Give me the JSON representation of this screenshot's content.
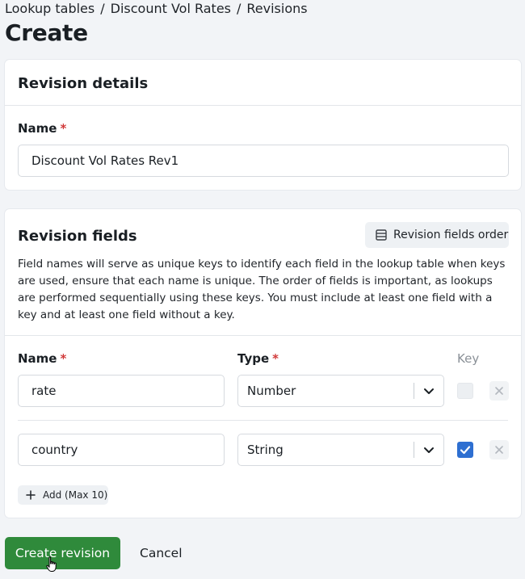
{
  "breadcrumb": {
    "items": [
      "Lookup tables",
      "Discount Vol Rates",
      "Revisions"
    ],
    "separator": "/"
  },
  "page": {
    "title": "Create"
  },
  "revision_details": {
    "title": "Revision details",
    "name_label": "Name",
    "required_mark": "*",
    "name_value": "Discount Vol Rates Rev1"
  },
  "revision_fields": {
    "title": "Revision fields",
    "order_button_label": "Revision fields order",
    "description": "Field names will serve as unique keys to identify each field in the lookup table when keys are used, ensure that each name is unique. The order of fields is important, as lookups are performed sequentially using these keys. You must include at least one field with a key and at least one field without a key.",
    "columns": {
      "name": "Name",
      "type": "Type",
      "key": "Key"
    },
    "required_mark": "*",
    "rows": [
      {
        "name": "rate",
        "type": "Number",
        "key": false
      },
      {
        "name": "country",
        "type": "String",
        "key": true
      }
    ],
    "add_button_label": "Add (Max 10)"
  },
  "actions": {
    "primary_label": "Create revision",
    "cancel_label": "Cancel"
  },
  "colors": {
    "primary": "#2f8a3b",
    "checkbox_checked": "#2e6fd1",
    "required": "#d13a3a"
  },
  "icons": [
    "table-icon",
    "chevron-down-icon",
    "check-icon",
    "close-icon",
    "plus-icon",
    "hand-cursor-icon"
  ]
}
